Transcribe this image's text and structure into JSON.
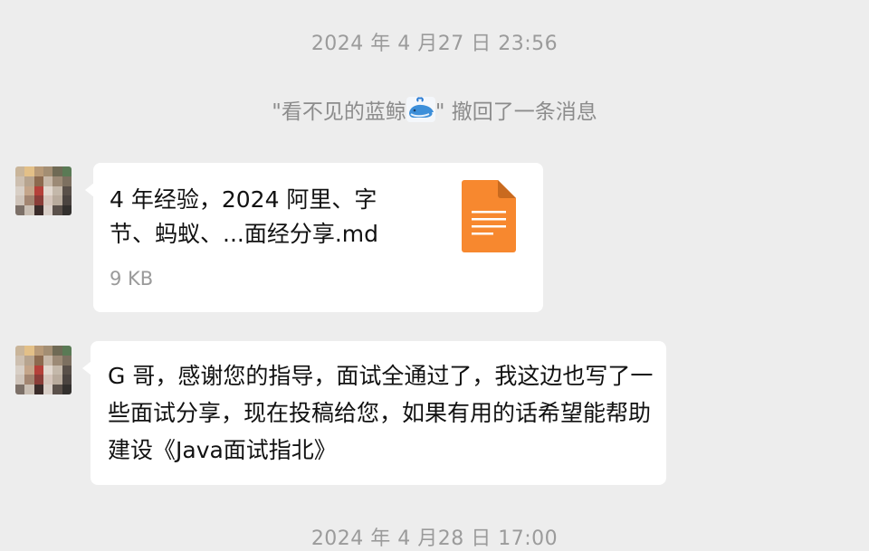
{
  "chat": {
    "timestamp_top": "2024 年 4 月27 日 23:56",
    "timestamp_bottom": "2024 年 4 月28 日 17:00",
    "system_message": {
      "prefix": "\"看不见的蓝鲸",
      "icon": "whale-emoji",
      "suffix": "\" 撤回了一条消息"
    },
    "messages": [
      {
        "type": "file",
        "sender_avatar": "pixelated-avatar",
        "file_name": "4 年经验，2024 阿里、字节、蚂蚁、...面经分享.md",
        "file_size": "9 KB",
        "file_icon": "document-icon",
        "file_icon_color": "#f7882f"
      },
      {
        "type": "text",
        "sender_avatar": "pixelated-avatar",
        "text": "G 哥，感谢您的指导，面试全通过了，我这边也写了一些面试分享，现在投稿给您，如果有用的话希望能帮助建设《Java面试指北》"
      }
    ]
  }
}
